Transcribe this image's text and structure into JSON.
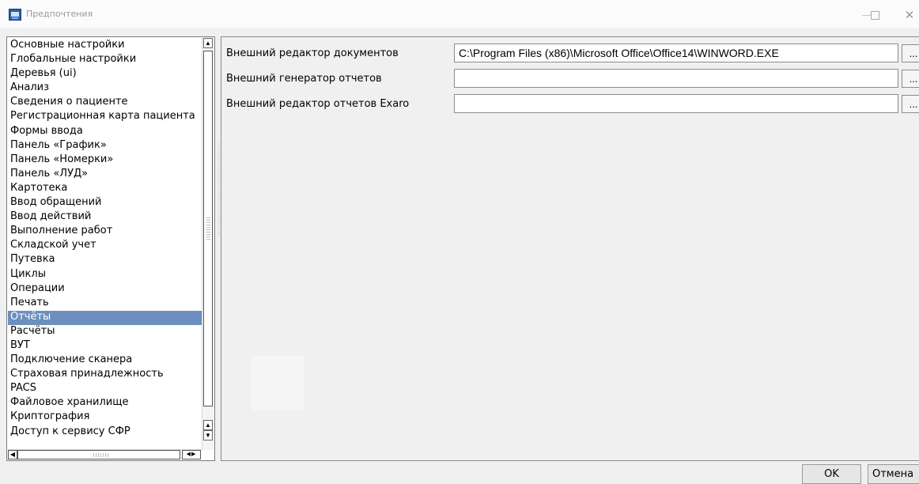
{
  "window": {
    "title": "Предпочтения"
  },
  "categories": [
    {
      "label": "Основные настройки",
      "selected": false
    },
    {
      "label": "Глобальные настройки",
      "selected": false
    },
    {
      "label": "Деревья (ui)",
      "selected": false
    },
    {
      "label": "Анализ",
      "selected": false
    },
    {
      "label": "Сведения о пациенте",
      "selected": false
    },
    {
      "label": "Регистрационная карта пациента",
      "selected": false
    },
    {
      "label": "Формы ввода",
      "selected": false
    },
    {
      "label": "Панель «График»",
      "selected": false
    },
    {
      "label": "Панель «Номерки»",
      "selected": false
    },
    {
      "label": "Панель «ЛУД»",
      "selected": false
    },
    {
      "label": "Картотека",
      "selected": false
    },
    {
      "label": "Ввод обращений",
      "selected": false
    },
    {
      "label": "Ввод действий",
      "selected": false
    },
    {
      "label": "Выполнение работ",
      "selected": false
    },
    {
      "label": "Складской учет",
      "selected": false
    },
    {
      "label": "Путевка",
      "selected": false
    },
    {
      "label": "Циклы",
      "selected": false
    },
    {
      "label": "Операции",
      "selected": false
    },
    {
      "label": "Печать",
      "selected": false
    },
    {
      "label": "Отчёты",
      "selected": true
    },
    {
      "label": "Расчёты",
      "selected": false
    },
    {
      "label": "ВУТ",
      "selected": false
    },
    {
      "label": "Подключение сканера",
      "selected": false
    },
    {
      "label": "Страховая принадлежность",
      "selected": false
    },
    {
      "label": "PACS",
      "selected": false
    },
    {
      "label": "Файловое хранилище",
      "selected": false
    },
    {
      "label": "Криптография",
      "selected": false
    },
    {
      "label": "Доступ к сервису СФР",
      "selected": false
    }
  ],
  "settings": [
    {
      "label": "Внешний редактор документов",
      "value": "C:\\Program Files (x86)\\Microsoft Office\\Office14\\WINWORD.EXE",
      "browse": "..."
    },
    {
      "label": "Внешний генератор отчетов",
      "value": "",
      "browse": "..."
    },
    {
      "label": "Внешний редактор отчетов Exaro",
      "value": "",
      "browse": "..."
    }
  ],
  "buttons": {
    "ok": "OK",
    "cancel": "Отмена"
  },
  "colors": {
    "selection": "#6c8fbf"
  },
  "icons": [
    "app-icon",
    "minimize-icon",
    "maximize-icon",
    "close-icon"
  ]
}
